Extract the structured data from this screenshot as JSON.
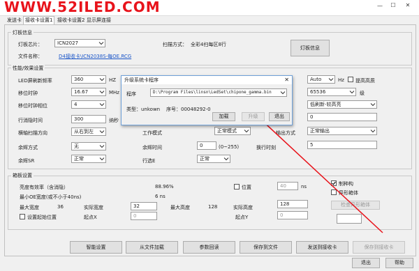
{
  "watermark": "WWW.52ILED.COM",
  "window": {
    "controls": {
      "minimize": "—",
      "maximize": "☐",
      "close": "✕"
    }
  },
  "tabs": [
    "发送卡",
    "接收卡设置1",
    "接收卡设置2",
    "显示屏连接"
  ],
  "board_info": {
    "title": "灯板信息",
    "chip_label": "灯板芯片：",
    "chip_value": "ICN2027",
    "scan_label": "扫描方式：",
    "scan_value": "全彩4扫每区8行",
    "file_label": "文件名称：",
    "file_value": "D4接收卡\\ICN2038S-每OE.RCG",
    "info_button": "灯板信息"
  },
  "perf": {
    "title": "性能/效果设置",
    "refresh_label": "LED屏刷新频率",
    "refresh_value": "360",
    "refresh_unit": "HZ",
    "auto_value": "Auto",
    "hz_unit": "Hz",
    "boost_label": "提高高质",
    "shift_label": "移位时钟",
    "shift_value": "16.67",
    "shift_unit": "MHz",
    "gray_value": "65536",
    "gray_unit": "级",
    "phase_label": "移位时钟相位",
    "phase_value": "4",
    "lowgray_value": "低刷新-较高亮",
    "blank_label": "行消隐时间",
    "blank_value": "300",
    "blank_unit": "纳秒",
    "right_val3": "0",
    "scan_dir_label": "横轴扫描方向",
    "scan_dir_value": "从右到左",
    "mode_label": "工作模式",
    "mode_value": "正常模式",
    "out_label": "输出方式",
    "out_value": "正常输出",
    "after_label": "余辉方式",
    "after_value": "无",
    "after_time_label": "余辉时间",
    "after_time_value": "0",
    "after_time_range": "(0~255)",
    "swap_label": "换行时刻",
    "swap_value": "5",
    "after_sr_label": "余辉SR",
    "after_sr_value": "正常",
    "row_label": "行选E",
    "row_value": "正常"
  },
  "cabinet": {
    "title": "箱板设置",
    "duty_label": "亮度有效率（含消隐）",
    "duty_value": "88.96%",
    "pos_label": "位置",
    "pos_value": "40",
    "pos_unit": "ns",
    "min_oe_label": "最小OE宽度(或不小于40ns)",
    "min_oe_value": "6 ns",
    "max_w_label": "最大宽度",
    "max_w_value": "36",
    "real_w_label": "实际宽度",
    "real_w_value": "32",
    "max_h_label": "最大高度",
    "max_h_value": "128",
    "real_h_label": "实际高度",
    "real_h_value": "128",
    "start_pos_label": "设置起始位置",
    "start_x_label": "起点X",
    "start_x_value": "0",
    "start_y_label": "起点Y",
    "start_y_value": "0",
    "custom_label": "制种构",
    "special_label": "异形箱体",
    "check_button": "检查异形箱体"
  },
  "bottom": {
    "smart": "智能设置",
    "from_file": "从文件加载",
    "param_back": "参数回读",
    "save_file": "保存到文件",
    "send": "发送到接收卡",
    "save_card": "保存到接收卡",
    "exit": "退出",
    "help": "帮助"
  },
  "dialog": {
    "title": "升级系统卡程序",
    "close": "✕",
    "program_label": "程序",
    "program_path": "D:\\Program Files\\linsn\\LedSet\\chipone_gamma.bin",
    "type_label": "类型：unkown",
    "serial_label": "序号：00048292-0",
    "load": "加载",
    "upgrade": "升级",
    "exit": "退出"
  },
  "colors": {
    "watermark": "#e8131b",
    "arrow": "#e8131b",
    "link": "#1a55c8"
  }
}
